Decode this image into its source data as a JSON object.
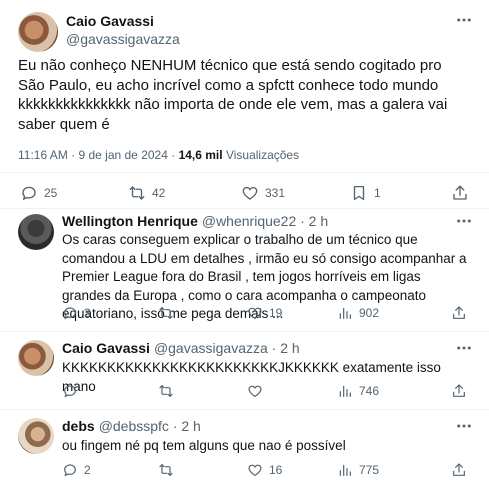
{
  "main_tweet": {
    "author_name": "Caio Gavassi",
    "author_handle": "@gavassigavazza",
    "text": "Eu não conheço NENHUM técnico que está sendo cogitado pro São Paulo, eu acho incrível como a spfctt conhece todo mundo kkkkkkkkkkkkkkk não importa de onde ele vem, mas a galera vai saber quem é",
    "time": "11:16 AM · 9 de jan de 2024 ·",
    "views_count": "14,6 mil",
    "views_label": "Visualizações",
    "replies": "25",
    "retweets": "42",
    "likes": "331",
    "bookmarks": "1"
  },
  "replies": [
    {
      "name": "Wellington Henrique",
      "handle": "@whenrique22 · 2 h",
      "text": "Os caras conseguem explicar o trabalho de um técnico que comandou a LDU em detalhes , irmão eu só consigo acompanhar a Premier League fora do Brasil , tem jogos horríveis em ligas grandes da Europa , como o cara acompanha o campeonato equatoriano, isso me pega demais ...",
      "replies": "3",
      "retweets": "",
      "likes": "19",
      "views": "902"
    },
    {
      "name": "Caio Gavassi",
      "handle": "@gavassigavazza · 2 h",
      "text": "KKKKKKKKKKKKKKKKKKKKKKKKJKKKKKK exatamente isso mano",
      "replies": "",
      "retweets": "",
      "likes": "",
      "views": "746"
    },
    {
      "name": "debs",
      "handle": "@debsspfc · 2 h",
      "text": "ou fingem né pq tem alguns que nao é possível",
      "replies": "2",
      "retweets": "",
      "likes": "16",
      "views": "775"
    }
  ],
  "icons": {
    "reply": "speech-bubble-icon",
    "retweet": "retweet-arrows-icon",
    "like": "heart-icon",
    "views": "bar-chart-icon",
    "bookmark": "bookmark-icon",
    "share": "share-upload-icon",
    "more": "more-dots-icon"
  },
  "colors": {
    "text": "#0f1419",
    "secondary": "#536471",
    "divider": "#eff3f4"
  }
}
